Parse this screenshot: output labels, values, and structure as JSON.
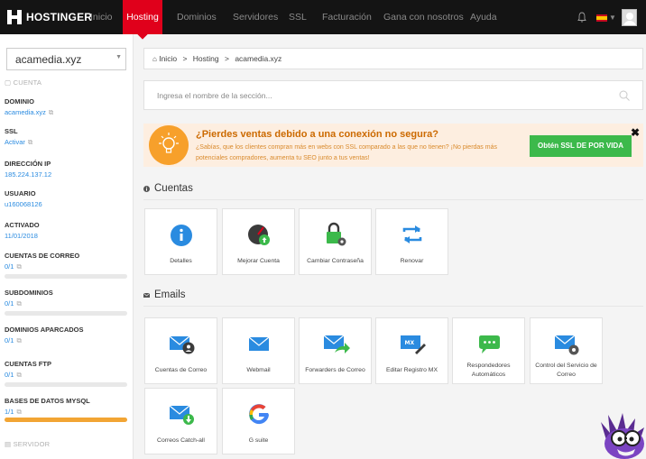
{
  "nav": {
    "brand": "HOSTINGER",
    "items": [
      {
        "label": "Inicio"
      },
      {
        "label": "Hosting"
      },
      {
        "label": "Dominios"
      },
      {
        "label": "Servidores"
      },
      {
        "label": "SSL"
      },
      {
        "label": "Facturación"
      },
      {
        "label": "Gana con nosotros"
      },
      {
        "label": "Ayuda"
      }
    ],
    "active": "Hosting",
    "icons": [
      "bell-icon",
      "spain-flag-icon",
      "avatar"
    ]
  },
  "sidebar": {
    "domain_select": "acamedia.xyz",
    "section_account": "CUENTA",
    "fields": [
      {
        "label": "DOMINIO",
        "value": "acamedia.xyz"
      },
      {
        "label": "SSL",
        "value": "Activar"
      },
      {
        "label": "DIRECCIÓN IP",
        "value": "185.224.137.12"
      },
      {
        "label": "USUARIO",
        "value": "u160068126"
      },
      {
        "label": "ACTIVADO",
        "value": "11/01/2018"
      },
      {
        "label": "CUENTAS DE CORREO",
        "value": "0/1"
      },
      {
        "label": "SUBDOMINIOS",
        "value": "0/1"
      },
      {
        "label": "DOMINIOS APARCADOS",
        "value": "0/1"
      },
      {
        "label": "CUENTAS FTP",
        "value": "0/1"
      },
      {
        "label": "BASES DE DATOS MYSQL",
        "value": "1/1"
      }
    ],
    "usage": {
      "correo": 0,
      "subdominios": 0,
      "ftp": 0,
      "mysql": 1
    },
    "section_server": "SERVIDOR"
  },
  "breadcrumb": [
    "Inicio",
    "Hosting",
    "acamedia.xyz"
  ],
  "breadcrumb_sep": ">",
  "search": {
    "placeholder": "Ingresa el nombre de la sección..."
  },
  "banner": {
    "title": "¿Pierdes ventas debido a una conexión no segura?",
    "text": "¿Sabías, que los clientes compran más en webs con SSL comparado a las que no tienen? ¡No pierdas más potenciales compradores, aumenta tu SEO junto a tus ventas!",
    "button": "Obtén SSL DE POR VIDA",
    "close": "✖",
    "colors": {
      "bg": "#fdeee0",
      "button": "#3cb94b",
      "title": "#cc6a00"
    }
  },
  "sections": {
    "cuentas": {
      "title": "Cuentas",
      "tiles": [
        {
          "label": "Detalles",
          "icon": "info-icon"
        },
        {
          "label": "Mejorar Cuenta",
          "icon": "speedometer-upgrade-icon"
        },
        {
          "label": "Cambiar Contraseña",
          "icon": "lock-gear-icon"
        },
        {
          "label": "Renovar",
          "icon": "renew-arrows-icon"
        }
      ]
    },
    "emails": {
      "title": "Emails",
      "tiles": [
        {
          "label": "Cuentas de Correo",
          "icon": "mail-user-icon"
        },
        {
          "label": "Webmail",
          "icon": "mail-icon"
        },
        {
          "label": "Forwarders de Correo",
          "icon": "mail-forward-icon"
        },
        {
          "label": "Editar Registro MX",
          "icon": "mx-edit-icon"
        },
        {
          "label": "Respondedores Automáticos",
          "icon": "auto-reply-icon"
        },
        {
          "label": "Control del Servicio de Correo",
          "icon": "mail-settings-icon"
        },
        {
          "label": "Correos Catch-all",
          "icon": "mail-download-icon"
        },
        {
          "label": "G suite",
          "icon": "google-icon"
        }
      ]
    }
  }
}
